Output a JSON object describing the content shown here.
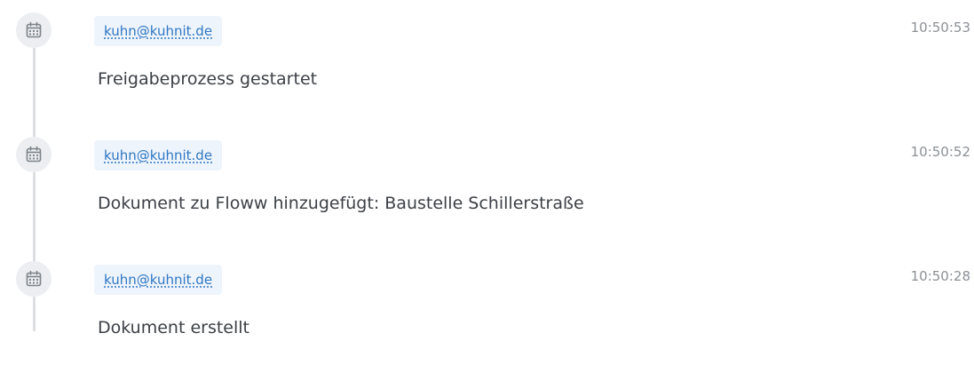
{
  "timeline": {
    "entries": [
      {
        "icon": "calendar-icon",
        "user": "kuhn@kuhnit.de",
        "time": "10:50:53",
        "message": "Freigabeprozess gestartet"
      },
      {
        "icon": "calendar-icon",
        "user": "kuhn@kuhnit.de",
        "time": "10:50:52",
        "message": "Dokument zu Floww hinzugefügt: Baustelle Schillerstraße"
      },
      {
        "icon": "calendar-icon",
        "user": "kuhn@kuhnit.de",
        "time": "10:50:28",
        "message": "Dokument erstellt"
      }
    ]
  },
  "colors": {
    "link": "#2f77c4",
    "badge_background": "#eef4fb",
    "icon_circle": "#eceef1",
    "icon_stroke": "#7e848b",
    "rail": "#dcdee2",
    "time": "#8b9096",
    "message": "#3c4046"
  }
}
